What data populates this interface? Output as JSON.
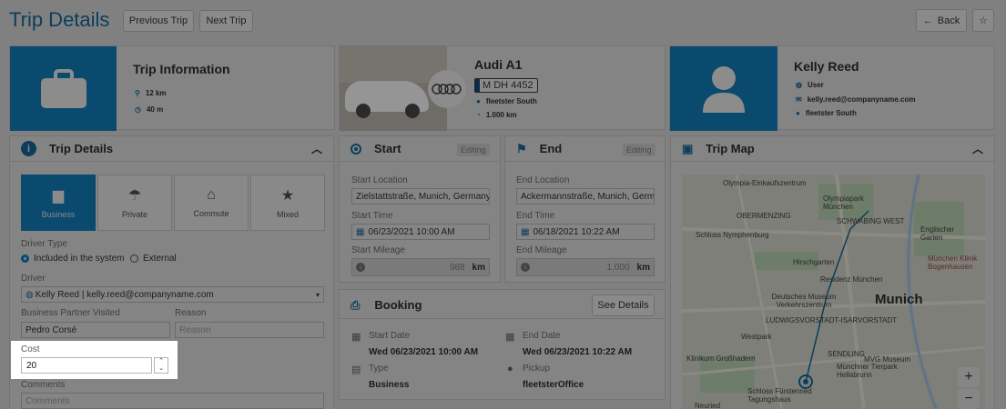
{
  "header": {
    "title": "Trip Details",
    "prev_label": "Previous Trip",
    "next_label": "Next Trip",
    "back_label": "Back"
  },
  "trip_info": {
    "title": "Trip Information",
    "distance": "12 km",
    "duration": "40 m"
  },
  "vehicle": {
    "name": "Audi A1",
    "plate": "M DH 4452",
    "location": "fleetster South",
    "mileage": "1.000 km"
  },
  "user": {
    "name": "Kelly Reed",
    "role": "User",
    "email": "kelly.reed@companyname.com",
    "location": "fleetster South"
  },
  "trip_details": {
    "title": "Trip Details",
    "types": [
      "Business",
      "Private",
      "Commute",
      "Mixed"
    ],
    "driver_type_label": "Driver Type",
    "driver_type_options": [
      "Included in the system",
      "External"
    ],
    "driver_label": "Driver",
    "driver_value": "Kelly Reed | kelly.reed@companyname.com",
    "partner_label": "Business Partner Visited",
    "partner_value": "Pedro Corsé",
    "reason_label": "Reason",
    "reason_placeholder": "Reason",
    "cost_label": "Cost",
    "cost_value": "20",
    "comments_label": "Comments",
    "comments_placeholder": "Comments"
  },
  "start": {
    "title": "Start",
    "tag": "Editing",
    "location_label": "Start Location",
    "location_value": "Zielstattstraße, Munich, Germany",
    "time_label": "Start Time",
    "time_value": "06/23/2021 10:00 AM",
    "mileage_label": "Start Mileage",
    "mileage_value": "988",
    "unit": "km"
  },
  "end": {
    "title": "End",
    "tag": "Editing",
    "location_label": "End Location",
    "location_value": "Ackermannstraße, Munich, Germany",
    "time_label": "End Time",
    "time_value": "06/18/2021 10:22 AM",
    "mileage_label": "End Mileage",
    "mileage_value": "1.000",
    "unit": "km"
  },
  "booking": {
    "title": "Booking",
    "details_label": "See Details",
    "start_date_label": "Start Date",
    "start_date_value": "Wed 06/23/2021 10:00 AM",
    "end_date_label": "End Date",
    "end_date_value": "Wed 06/23/2021 10:22 AM",
    "type_label": "Type",
    "type_value": "Business",
    "pickup_label": "Pickup",
    "pickup_value": "fleetsterOffice"
  },
  "map": {
    "title": "Trip Map",
    "city": "Munich",
    "labels": [
      "Olympia-Einkaufszentrum",
      "Olympiapark München",
      "Schloss Nymphenburg",
      "Hirschgarten",
      "Residenz München",
      "Deutsches Museum Verkehrszentrum",
      "LUDWIGSVORSTADT-ISARVORSTADT",
      "Westpark",
      "Klinikum Großhadern",
      "Münchner Tierpark Hellabrunn",
      "MVG Museum",
      "Schloss Fürstenried Tagungshaus",
      "Englischer Garten",
      "München Klinik Bogenhausen",
      "Neuried",
      "SCHWABING WEST",
      "OBERMENZING",
      "SENDLING"
    ],
    "zoom_in": "+",
    "zoom_out": "−"
  },
  "colors": {
    "accent": "#0a4a6e",
    "overlay": "#808080"
  }
}
